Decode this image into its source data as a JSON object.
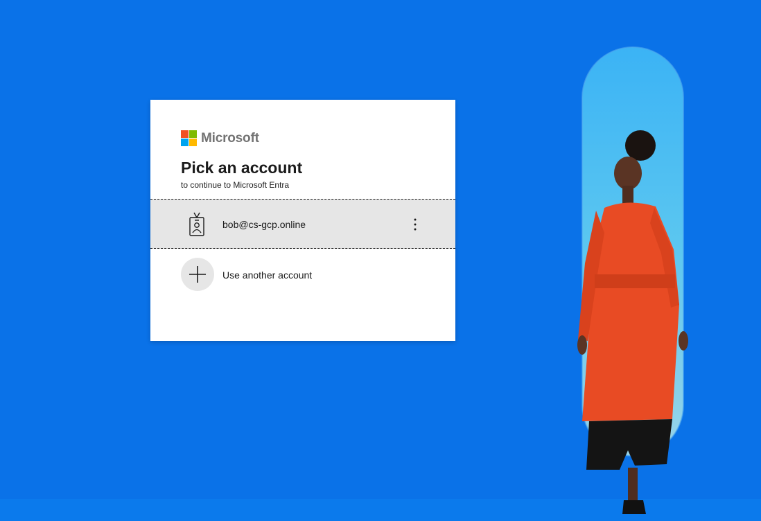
{
  "brand": {
    "name": "Microsoft",
    "logo_colors": [
      "#f25022",
      "#7fba00",
      "#00a4ef",
      "#ffb900"
    ]
  },
  "page": {
    "title": "Pick an account",
    "subtitle": "to continue to Microsoft Entra"
  },
  "accounts": [
    {
      "email": "bob@cs-gcp.online",
      "icon": "badge-icon",
      "options_icon": "more-options-icon"
    }
  ],
  "actions": {
    "use_another": "Use another account",
    "use_another_icon": "plus-icon"
  },
  "colors": {
    "background": "#0a72e8",
    "card": "#ffffff",
    "selected_row": "#e6e6e6"
  }
}
